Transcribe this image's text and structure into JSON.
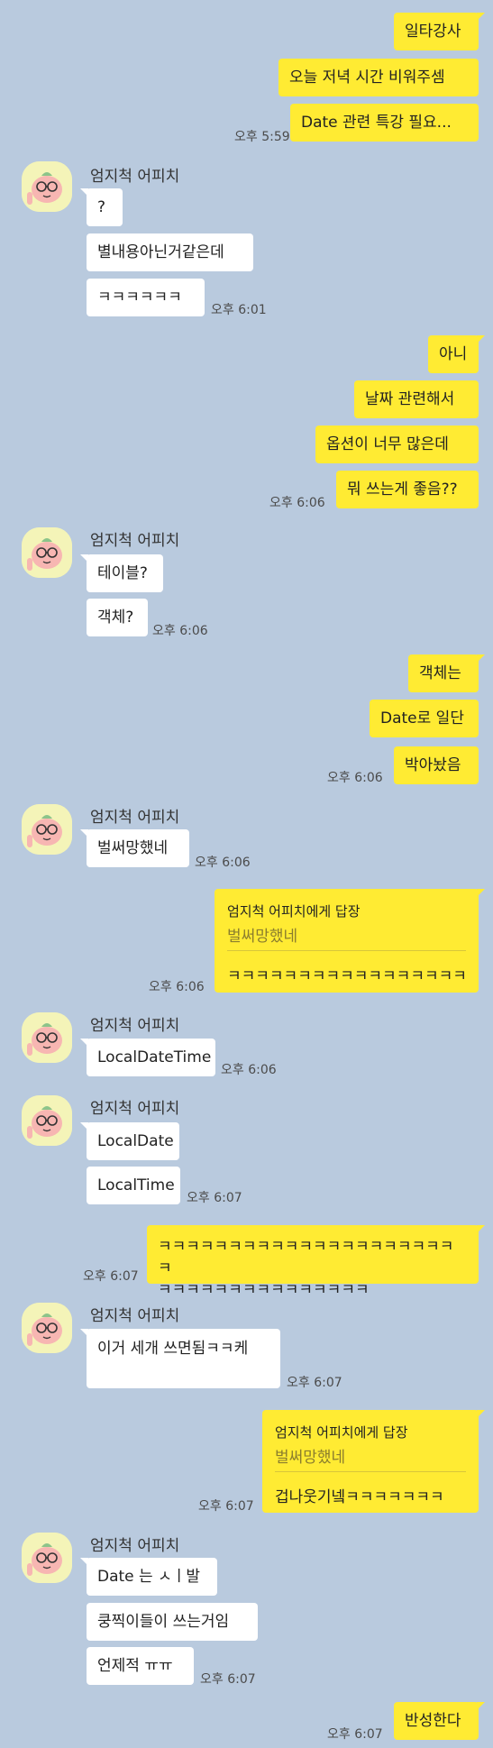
{
  "sender_name": "엄지척 어피치",
  "reply_prefix": "엄지척 어피치에게 답장",
  "times": {
    "t0559": "오후 5:59",
    "t0601": "오후 6:01",
    "t0606": "오후 6:06",
    "t0607": "오후 6:07"
  },
  "messages": {
    "m1": "일타강사",
    "m2": "오늘 저녁 시간 비워주셈",
    "m3": "Date 관련 특강 필요...",
    "o1": "?",
    "o2": "별내용아닌거같은데",
    "o3": "ㅋㅋㅋㅋㅋㅋ",
    "m4": "아니",
    "m5": "날짜 관련해서",
    "m6": "옵션이 너무 많은데",
    "m7": "뭐 쓰는게 좋음??",
    "o4": "테이블?",
    "o5": "객체?",
    "m8": "객체는",
    "m9": "Date로 일단",
    "m10": "박아놨음",
    "o6": "벌써망했네",
    "r1_quote": "벌써망했네",
    "r1_msg": "ㅋㅋㅋㅋㅋㅋㅋㅋㅋㅋㅋㅋㅋㅋㅋㅋㅋ",
    "o7": "LocalDateTime",
    "o8": "LocalDate",
    "o9": "LocalTime",
    "m11_line1": "ㅋㅋㅋㅋㅋㅋㅋㅋㅋㅋㅋㅋㅋㅋㅋㅋㅋㅋㅋㅋㅋㅋ",
    "m11_line2": "ㅋㅋㅋㅋㅋㅋㅋㅋㅋㅋㅋㅋㅋㅋㅋ",
    "o10": "이거 세개 쓰면됨ㅋㅋ케",
    "r2_quote": "벌써망했네",
    "r2_msg": "겁나웃기넼ㅋㅋㅋㅋㅋㅋㅋ",
    "o11": "Date 는 ㅅㅣ발",
    "o12": "쿵찍이들이 쓰는거임",
    "o13": "언제적 ㅠㅠ",
    "m12": "반성한다"
  },
  "colors": {
    "background": "#b9cade",
    "my_bubble": "#ffeb33",
    "other_bubble": "#ffffff"
  },
  "icons": {
    "avatar": "apeach-avatar-icon"
  }
}
